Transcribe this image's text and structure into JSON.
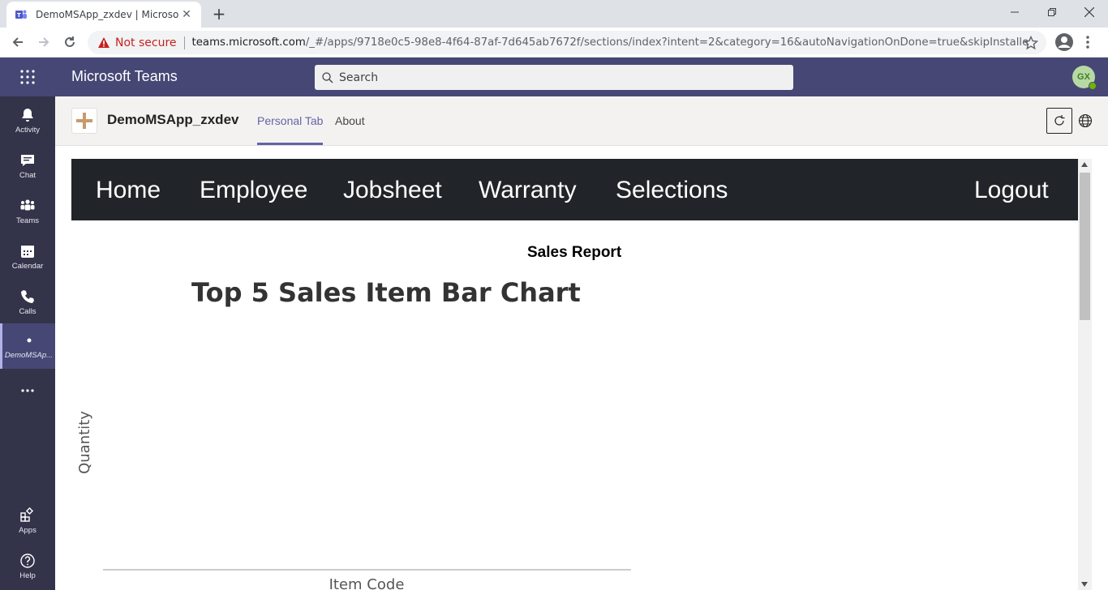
{
  "browser": {
    "tab_title": "DemoMSApp_zxdev | Microsoft Teams",
    "not_secure": "Not secure",
    "url_host": "teams.microsoft.com",
    "url_path": "/_#/apps/9718e0c5-98e8-4f64-87af-7d645ab7672f/sections/index?intent=2&category=16&autoNavigationOnDone=true&skipInstalledSuccess..."
  },
  "teams": {
    "title": "Microsoft Teams",
    "search_placeholder": "Search",
    "avatar_initials": "GX"
  },
  "rail": {
    "activity": "Activity",
    "chat": "Chat",
    "teams": "Teams",
    "calendar": "Calendar",
    "calls": "Calls",
    "app": "DemoMSAp...",
    "apps": "Apps",
    "help": "Help"
  },
  "app_header": {
    "name": "DemoMSApp_zxdev",
    "tab_personal": "Personal Tab",
    "tab_about": "About"
  },
  "app_nav": {
    "home": "Home",
    "employee": "Employee",
    "jobsheet": "Jobsheet",
    "warranty": "Warranty",
    "selections": "Selections",
    "logout": "Logout"
  },
  "report": {
    "title": "Sales Report"
  },
  "chart_data": {
    "type": "bar",
    "title": "Top 5 Sales Item Bar Chart",
    "xlabel": "Item Code",
    "ylabel": "Quantity",
    "categories": [],
    "values": []
  },
  "colors": {
    "teams_purple": "#464775",
    "rail_bg": "#33344a",
    "nav_dark": "#212529",
    "accent": "#6264a7"
  }
}
